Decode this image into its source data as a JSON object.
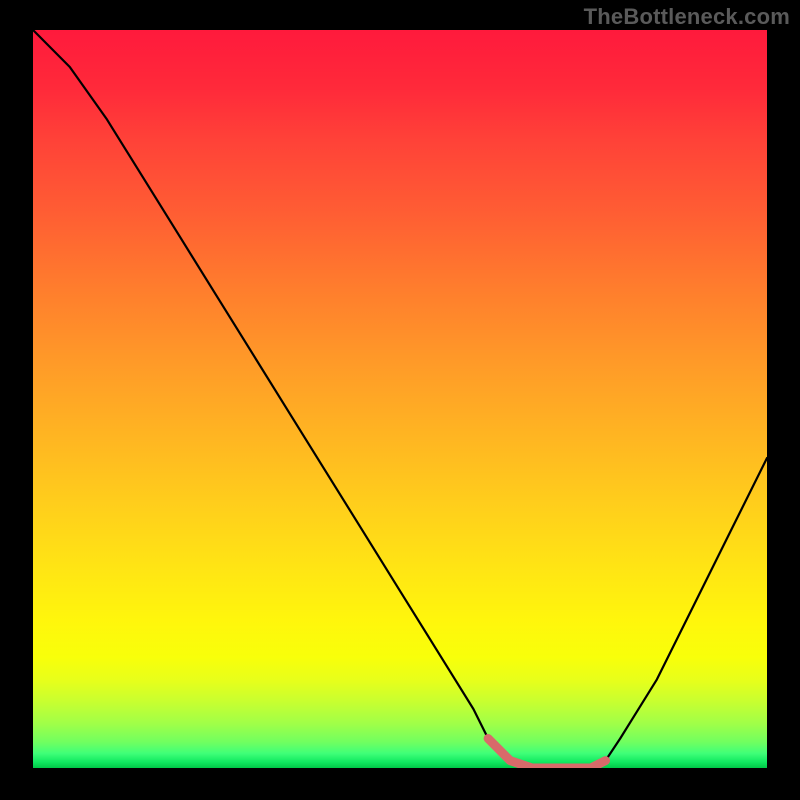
{
  "watermark": "TheBottleneck.com",
  "colors": {
    "background": "#000000",
    "curve_stroke": "#000000",
    "highlight_stroke": "#d86a6a",
    "watermark_text": "#5a5a5a"
  },
  "chart_data": {
    "type": "line",
    "title": "",
    "xlabel": "",
    "ylabel": "",
    "xlim": [
      0,
      100
    ],
    "ylim": [
      0,
      100
    ],
    "series": [
      {
        "name": "bottleneck-curve",
        "x": [
          0,
          5,
          10,
          15,
          20,
          25,
          30,
          35,
          40,
          45,
          50,
          55,
          60,
          62,
          65,
          68,
          70,
          73,
          76,
          78,
          80,
          85,
          90,
          95,
          100
        ],
        "y": [
          100,
          95,
          88,
          80,
          72,
          64,
          56,
          48,
          40,
          32,
          24,
          16,
          8,
          4,
          1,
          0,
          0,
          0,
          0,
          1,
          4,
          12,
          22,
          32,
          42
        ]
      }
    ],
    "highlight_segment": {
      "name": "optimal-range",
      "x": [
        62,
        65,
        68,
        70,
        73,
        76,
        78
      ],
      "y": [
        4,
        1,
        0,
        0,
        0,
        0,
        1
      ]
    }
  }
}
